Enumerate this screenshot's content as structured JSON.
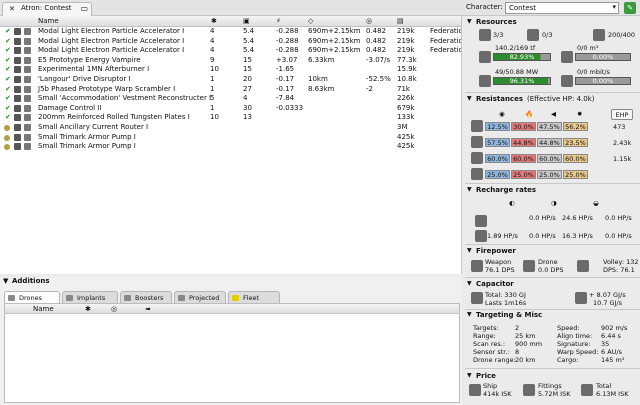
{
  "window": {
    "tab_title": "Atron: Contest",
    "character_label": "Character:",
    "character_value": "Contest"
  },
  "columns": {
    "name": "Name"
  },
  "modules": [
    {
      "name": "Modal Light Electron Particle Accelerator I",
      "c1": "4",
      "c2": "5.4",
      "c3": "-0.288",
      "c4": "690m+2.15km",
      "c5": "0.482",
      "c6": "219k",
      "c7": "Federation"
    },
    {
      "name": "Modal Light Electron Particle Accelerator I",
      "c1": "4",
      "c2": "5.4",
      "c3": "-0.288",
      "c4": "690m+2.15km",
      "c5": "0.482",
      "c6": "219k",
      "c7": "Federation"
    },
    {
      "name": "Modal Light Electron Particle Accelerator I",
      "c1": "4",
      "c2": "5.4",
      "c3": "-0.288",
      "c4": "690m+2.15km",
      "c5": "0.482",
      "c6": "219k",
      "c7": "Federation"
    },
    {
      "name": "E5 Prototype Energy Vampire",
      "c1": "9",
      "c2": "15",
      "c3": "+3.07",
      "c4": "6.33km",
      "c5": "-3.07/s",
      "c6": "77.3k",
      "c7": ""
    },
    {
      "name": "Experimental 1MN Afterburner I",
      "c1": "10",
      "c2": "15",
      "c3": "-1.65",
      "c4": "",
      "c5": "",
      "c6": "15.9k",
      "c7": ""
    },
    {
      "name": "'Langour' Drive Disruptor I",
      "c1": "1",
      "c2": "20",
      "c3": "-0.17",
      "c4": "10km",
      "c5": "-52.5%",
      "c6": "10.8k",
      "c7": ""
    },
    {
      "name": "J5b Phased Prototype Warp Scrambler I",
      "c1": "1",
      "c2": "27",
      "c3": "-0.17",
      "c4": "8.63km",
      "c5": "-2",
      "c6": "71k",
      "c7": ""
    },
    {
      "name": "Small 'Accommodation' Vestment Reconstructer I",
      "c1": "5",
      "c2": "4",
      "c3": "-7.84",
      "c4": "",
      "c5": "",
      "c6": "226k",
      "c7": ""
    },
    {
      "name": "Damage Control II",
      "c1": "1",
      "c2": "30",
      "c3": "-0.0333",
      "c4": "",
      "c5": "",
      "c6": "679k",
      "c7": ""
    },
    {
      "name": "200mm Reinforced Rolled Tungsten Plates I",
      "c1": "10",
      "c2": "13",
      "c3": "",
      "c4": "",
      "c5": "",
      "c6": "133k",
      "c7": ""
    },
    {
      "name": "Small Ancillary Current Router I",
      "c1": "",
      "c2": "",
      "c3": "",
      "c4": "",
      "c5": "",
      "c6": "3M",
      "c7": ""
    },
    {
      "name": "Small Trimark Armor Pump I",
      "c1": "",
      "c2": "",
      "c3": "",
      "c4": "",
      "c5": "",
      "c6": "425k",
      "c7": ""
    },
    {
      "name": "Small Trimark Armor Pump I",
      "c1": "",
      "c2": "",
      "c3": "",
      "c4": "",
      "c5": "",
      "c6": "425k",
      "c7": ""
    }
  ],
  "additions": {
    "title": "Additions",
    "tabs": [
      "Drones",
      "Implants",
      "Boosters",
      "Projected",
      "Fleet"
    ],
    "name_col": "Name"
  },
  "resources": {
    "title": "Resources",
    "turret": "3/3",
    "launcher": "0/3",
    "calib": "200/400",
    "cpu_text": "140.2/169 tf",
    "cpu_pct": "82.93%",
    "cpu_frac": 0.8293,
    "pg_text": "49/50.88 MW",
    "pg_pct": "96.31%",
    "pg_frac": 0.9631,
    "drone_bay": "0/0 m³",
    "drone_bay_pct": "0.00%",
    "bandwidth": "0/0 mbit/s",
    "bandwidth_pct": "0.00%"
  },
  "resistances": {
    "title": "Resistances",
    "ehp_text": "(Effective HP: 4.0k)",
    "ehp_button": "EHP",
    "rows": [
      {
        "em": "12.5%",
        "th": "30.0%",
        "ki": "47.5%",
        "ex": "56.2%",
        "hp": "473"
      },
      {
        "em": "57.5%",
        "th": "44.8%",
        "ki": "44.8%",
        "ex": "23.5%",
        "hp": "2.43k"
      },
      {
        "em": "60.0%",
        "th": "60.0%",
        "ki": "60.0%",
        "ex": "60.0%",
        "hp": "1.15k"
      },
      {
        "em": "25.0%",
        "th": "25.0%",
        "ki": "25.0%",
        "ex": "25.0%",
        "hp": ""
      }
    ]
  },
  "recharge": {
    "title": "Recharge rates",
    "r1": [
      "0.0 HP/s",
      "24.6 HP/s",
      "0.0 HP/s"
    ],
    "r2": [
      "1.89 HP/s",
      "0.0 HP/s",
      "16.3 HP/s",
      "0.0 HP/s"
    ]
  },
  "firepower": {
    "title": "Firepower",
    "weapon_label": "Weapon",
    "weapon_dps": "76.1 DPS",
    "drone_label": "Drone",
    "drone_dps": "0.0 DPS",
    "volley": "Volley: 132",
    "dps": "DPS: 76.1"
  },
  "capacitor": {
    "title": "Capacitor",
    "total": "Total: 330 GJ",
    "lasts": "Lasts 1m16s",
    "delta": "+ 8.07 GJ/s",
    "rate": "10.7 GJ/s"
  },
  "targeting": {
    "title": "Targeting & Misc",
    "left": [
      [
        "Targets:",
        "2"
      ],
      [
        "Range:",
        "25 km"
      ],
      [
        "Scan res.:",
        "900 mm"
      ],
      [
        "Sensor str.:",
        "8"
      ],
      [
        "Drone range:",
        "20 km"
      ]
    ],
    "right": [
      [
        "Speed:",
        "902 m/s"
      ],
      [
        "Align time:",
        "6.44 s"
      ],
      [
        "Signature:",
        "35"
      ],
      [
        "Warp Speed:",
        "6 AU/s"
      ],
      [
        "Cargo:",
        "145 m³"
      ]
    ]
  },
  "price": {
    "title": "Price",
    "ship_label": "Ship",
    "ship": "414k ISK",
    "fit_label": "Fittings",
    "fit": "5.72M ISK",
    "total_label": "Total",
    "total": "6.13M ISK"
  },
  "colors": {
    "accent_green": "#2d8c2d",
    "em": "#8fb6df",
    "thermal": "#e37a7a",
    "kinetic": "#c8c8c8",
    "explosive": "#e7c78c"
  }
}
